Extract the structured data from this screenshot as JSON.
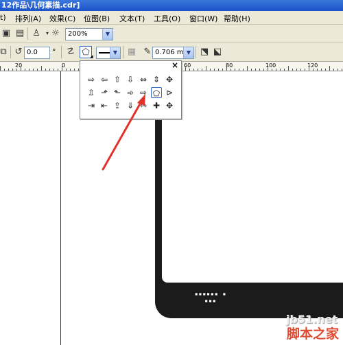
{
  "window": {
    "title": "12作品\\几何素描.cdr]"
  },
  "menubar": {
    "items": [
      {
        "label": "t)"
      },
      {
        "label": "排列(A)"
      },
      {
        "label": "效果(C)"
      },
      {
        "label": "位图(B)"
      },
      {
        "label": "文本(T)"
      },
      {
        "label": "工具(O)"
      },
      {
        "label": "窗口(W)"
      },
      {
        "label": "帮助(H)"
      }
    ]
  },
  "toolbar1": {
    "zoom_value": "200%"
  },
  "toolbar2": {
    "rotation_value": "0.0",
    "degree_symbol": "°",
    "outline_width": "0.706 mm"
  },
  "ruler": {
    "labels": [
      "20",
      "0",
      "60",
      "80",
      "100",
      "120"
    ]
  },
  "arrow_picker": {
    "close_label": "×",
    "rows": [
      [
        "⇨",
        "⇦",
        "⇧",
        "⇩",
        "⇔",
        "⇕",
        "✥"
      ],
      [
        "⇫",
        "⬏",
        "⬑",
        "➾",
        "⇨",
        "⬠",
        "⊳"
      ],
      [
        "⇥",
        "⇤",
        "⇪",
        "⇓",
        "⇿",
        "✚",
        "✥"
      ]
    ],
    "selected": "pentagon-arrow"
  },
  "canvas": {
    "barcode_text": "▪▪▪▪▪▪ ▪ ▪▪▪"
  },
  "watermark": {
    "url": "jb51.net",
    "site_name": "脚本之家"
  }
}
